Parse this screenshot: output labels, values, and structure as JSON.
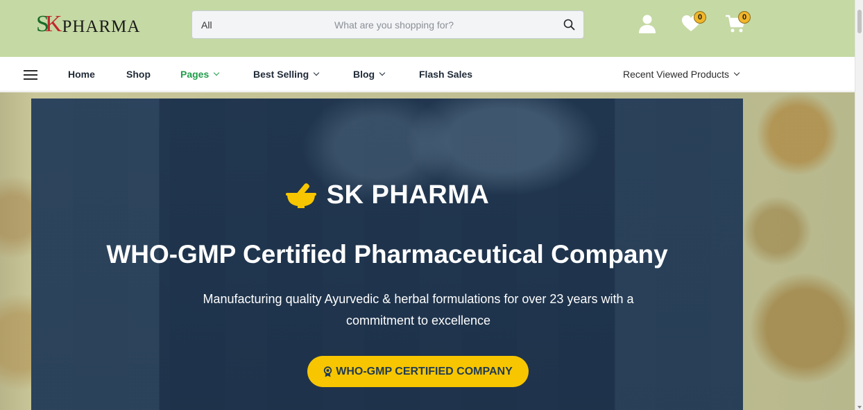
{
  "header": {
    "logo": {
      "mark": "SK",
      "text": "PHARMA"
    },
    "search": {
      "category": "All",
      "placeholder": "What are you shopping for?",
      "value": ""
    },
    "icons": [
      {
        "name": "user-icon"
      },
      {
        "name": "heart-icon",
        "badge": "0"
      },
      {
        "name": "cart-icon",
        "badge": "0"
      }
    ]
  },
  "nav": {
    "items": [
      {
        "label": "Home",
        "active": false,
        "dropdown": false
      },
      {
        "label": "Shop",
        "active": false,
        "dropdown": false
      },
      {
        "label": "Pages",
        "active": true,
        "dropdown": true
      },
      {
        "label": "Best Selling",
        "active": false,
        "dropdown": true
      },
      {
        "label": "Blog",
        "active": false,
        "dropdown": true
      },
      {
        "label": "Flash Sales",
        "active": false,
        "dropdown": false
      }
    ],
    "recent": "Recent Viewed Products"
  },
  "hero": {
    "brand": "SK PHARMA",
    "title": "WHO-GMP Certified Pharmaceutical Company",
    "subtitle": "Manufacturing quality Ayurvedic & herbal formulations for over 23 years with a commitment to excellence",
    "cta": "WHO-GMP CERTIFIED COMPANY"
  },
  "colors": {
    "header_bg": "#c5d9a4",
    "nav_active": "#1f9d4a",
    "cta_bg": "#f7c600",
    "badge": "#f1b62a"
  }
}
